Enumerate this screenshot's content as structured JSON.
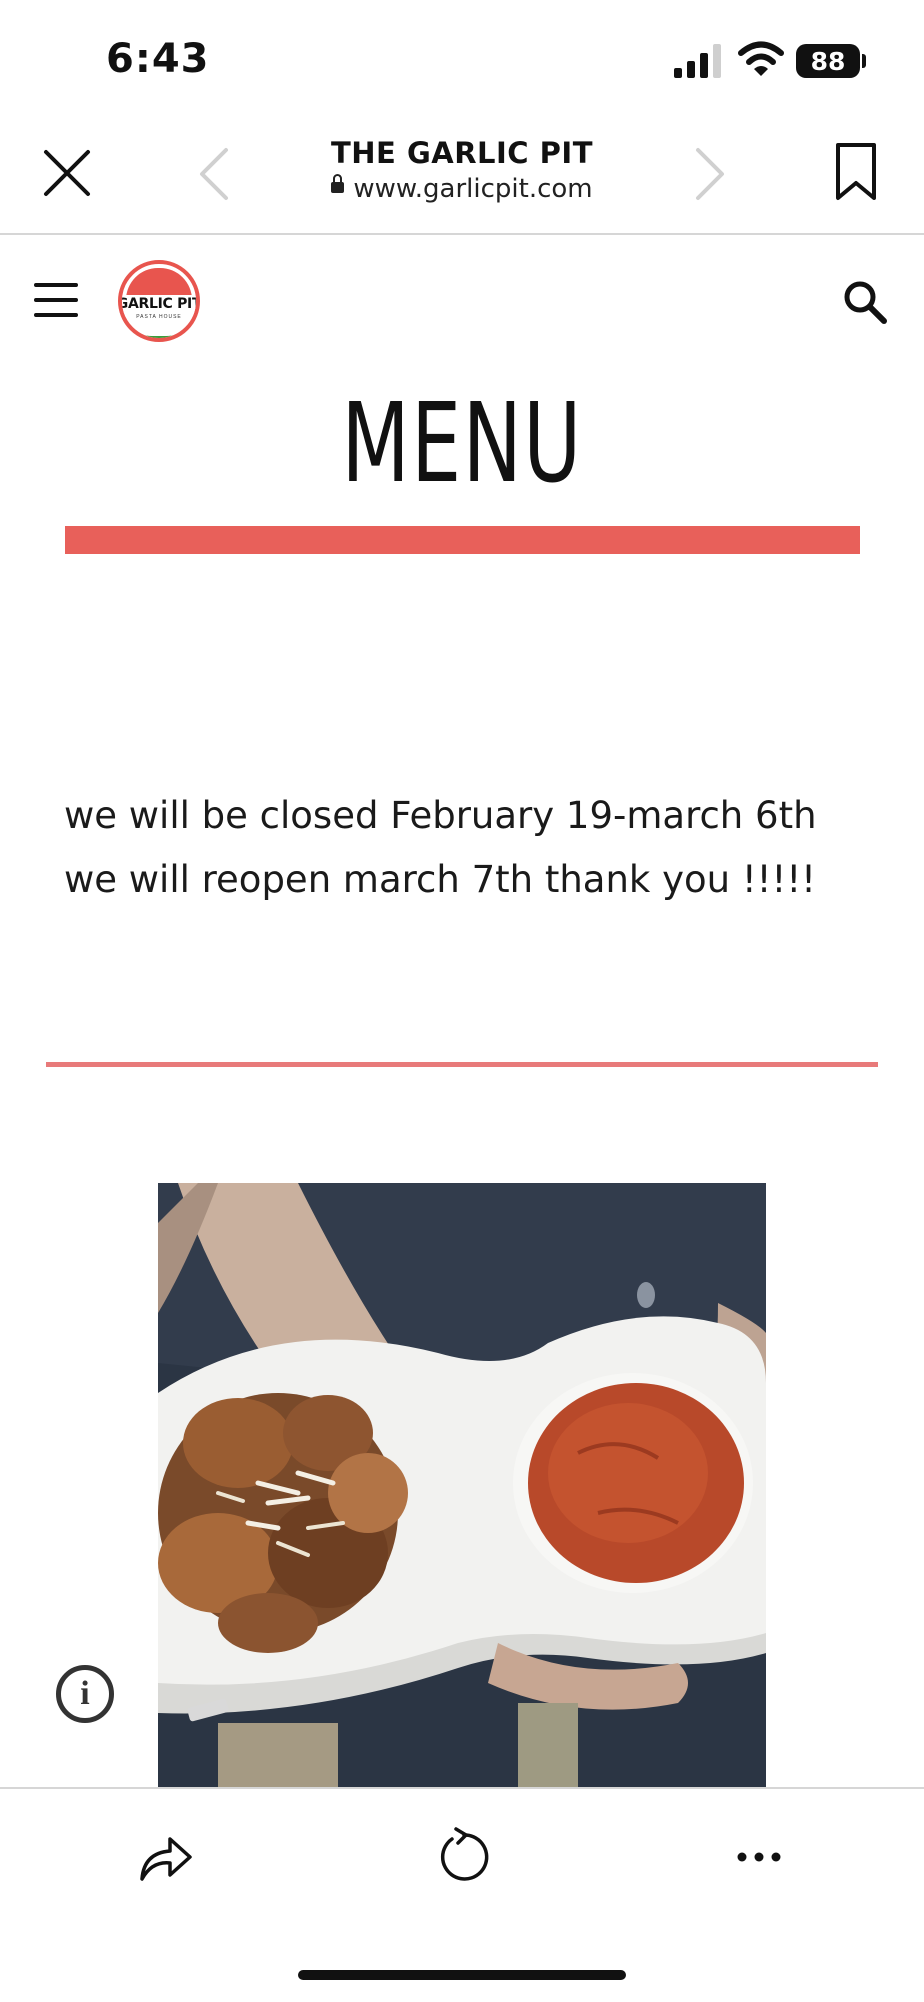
{
  "status_bar": {
    "time": "6:43",
    "battery": "88"
  },
  "browser": {
    "title": "THE GARLIC PIT",
    "url": "www.garlicpit.com"
  },
  "site": {
    "logo_text": "GARLIC PIT",
    "logo_subtext": "PASTA HOUSE"
  },
  "page": {
    "heading": "MENU",
    "notice": "we will be closed February 19-march 6th we will reopen march 7th thank you !!!!!"
  },
  "colors": {
    "accent": "#e8605a",
    "logo_green": "#3d9b3a"
  },
  "icons": [
    "close-icon",
    "back-arrow-icon",
    "forward-arrow-icon",
    "bookmark-icon",
    "hamburger-menu-icon",
    "search-icon",
    "info-icon",
    "share-icon",
    "reload-icon",
    "more-icon"
  ]
}
